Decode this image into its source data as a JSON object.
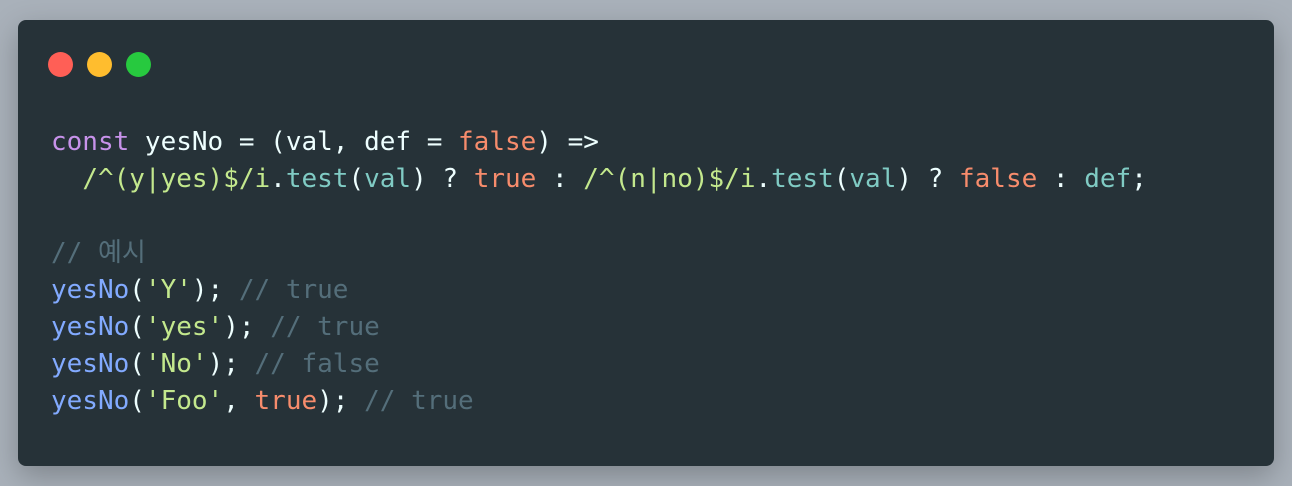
{
  "window": {
    "buttons": {
      "close_color": "#ff5f56",
      "minimize_color": "#ffbd2e",
      "maximize_color": "#27c93f"
    },
    "background_color": "#263238"
  },
  "code": {
    "language": "javascript",
    "lines": [
      [
        {
          "t": "const",
          "c": "kw"
        },
        {
          "t": " yesNo = (val, def = ",
          "c": "op"
        },
        {
          "t": "false",
          "c": "bool"
        },
        {
          "t": ") =>",
          "c": "op"
        }
      ],
      [
        {
          "t": "  ",
          "c": "op"
        },
        {
          "t": "/^(y|yes)$/i",
          "c": "re"
        },
        {
          "t": ".",
          "c": "op"
        },
        {
          "t": "test",
          "c": "prm"
        },
        {
          "t": "(",
          "c": "op"
        },
        {
          "t": "val",
          "c": "prm"
        },
        {
          "t": ") ? ",
          "c": "op"
        },
        {
          "t": "true",
          "c": "bool"
        },
        {
          "t": " : ",
          "c": "op"
        },
        {
          "t": "/^(n|no)$/i",
          "c": "re"
        },
        {
          "t": ".",
          "c": "op"
        },
        {
          "t": "test",
          "c": "prm"
        },
        {
          "t": "(",
          "c": "op"
        },
        {
          "t": "val",
          "c": "prm"
        },
        {
          "t": ") ? ",
          "c": "op"
        },
        {
          "t": "false",
          "c": "bool"
        },
        {
          "t": " : ",
          "c": "op"
        },
        {
          "t": "def",
          "c": "prm"
        },
        {
          "t": ";",
          "c": "op"
        }
      ],
      [],
      [
        {
          "t": "// 예시",
          "c": "cm"
        }
      ],
      [
        {
          "t": "yesNo",
          "c": "fn"
        },
        {
          "t": "(",
          "c": "op"
        },
        {
          "t": "'Y'",
          "c": "str"
        },
        {
          "t": "); ",
          "c": "op"
        },
        {
          "t": "// true",
          "c": "cm"
        }
      ],
      [
        {
          "t": "yesNo",
          "c": "fn"
        },
        {
          "t": "(",
          "c": "op"
        },
        {
          "t": "'yes'",
          "c": "str"
        },
        {
          "t": "); ",
          "c": "op"
        },
        {
          "t": "// true",
          "c": "cm"
        }
      ],
      [
        {
          "t": "yesNo",
          "c": "fn"
        },
        {
          "t": "(",
          "c": "op"
        },
        {
          "t": "'No'",
          "c": "str"
        },
        {
          "t": "); ",
          "c": "op"
        },
        {
          "t": "// false",
          "c": "cm"
        }
      ],
      [
        {
          "t": "yesNo",
          "c": "fn"
        },
        {
          "t": "(",
          "c": "op"
        },
        {
          "t": "'Foo'",
          "c": "str"
        },
        {
          "t": ", ",
          "c": "op"
        },
        {
          "t": "true",
          "c": "bool"
        },
        {
          "t": "); ",
          "c": "op"
        },
        {
          "t": "// true",
          "c": "cm"
        }
      ]
    ]
  }
}
